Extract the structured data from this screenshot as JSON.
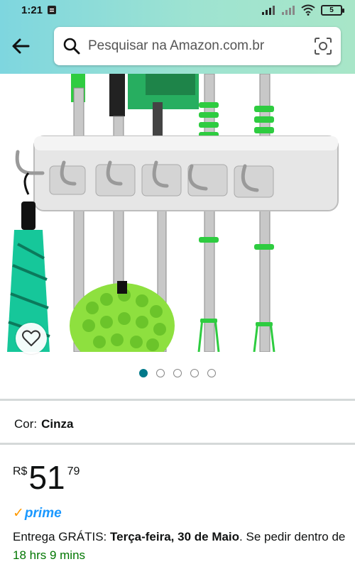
{
  "status_bar": {
    "time": "1:21",
    "battery_level": "5"
  },
  "header": {
    "search_placeholder": "Pesquisar na Amazon.com.br",
    "back_icon": "arrow-left-icon",
    "search_icon": "magnifier-icon",
    "camera_icon": "camera-scan-icon",
    "gradient_colors": [
      "#7ed6df",
      "#a8e6c8"
    ]
  },
  "gallery": {
    "image_count": 5,
    "active_index": 0,
    "favorite_icon": "heart-icon"
  },
  "product": {
    "color_label": "Cor:",
    "color_value": "Cinza",
    "price_currency": "R$",
    "price_whole": "51",
    "price_cents": "79",
    "prime_label": "prime",
    "delivery_prefix": "Entrega GRÁTIS: ",
    "delivery_date": "Terça-feira, 30 de Maio",
    "delivery_mid": ". Se pedir dentro de ",
    "delivery_countdown": "18 hrs 9 mins"
  },
  "colors": {
    "accent": "#00798a",
    "prime_blue": "#1a98ff",
    "prime_check": "#ff9900",
    "green_text": "#007600"
  }
}
